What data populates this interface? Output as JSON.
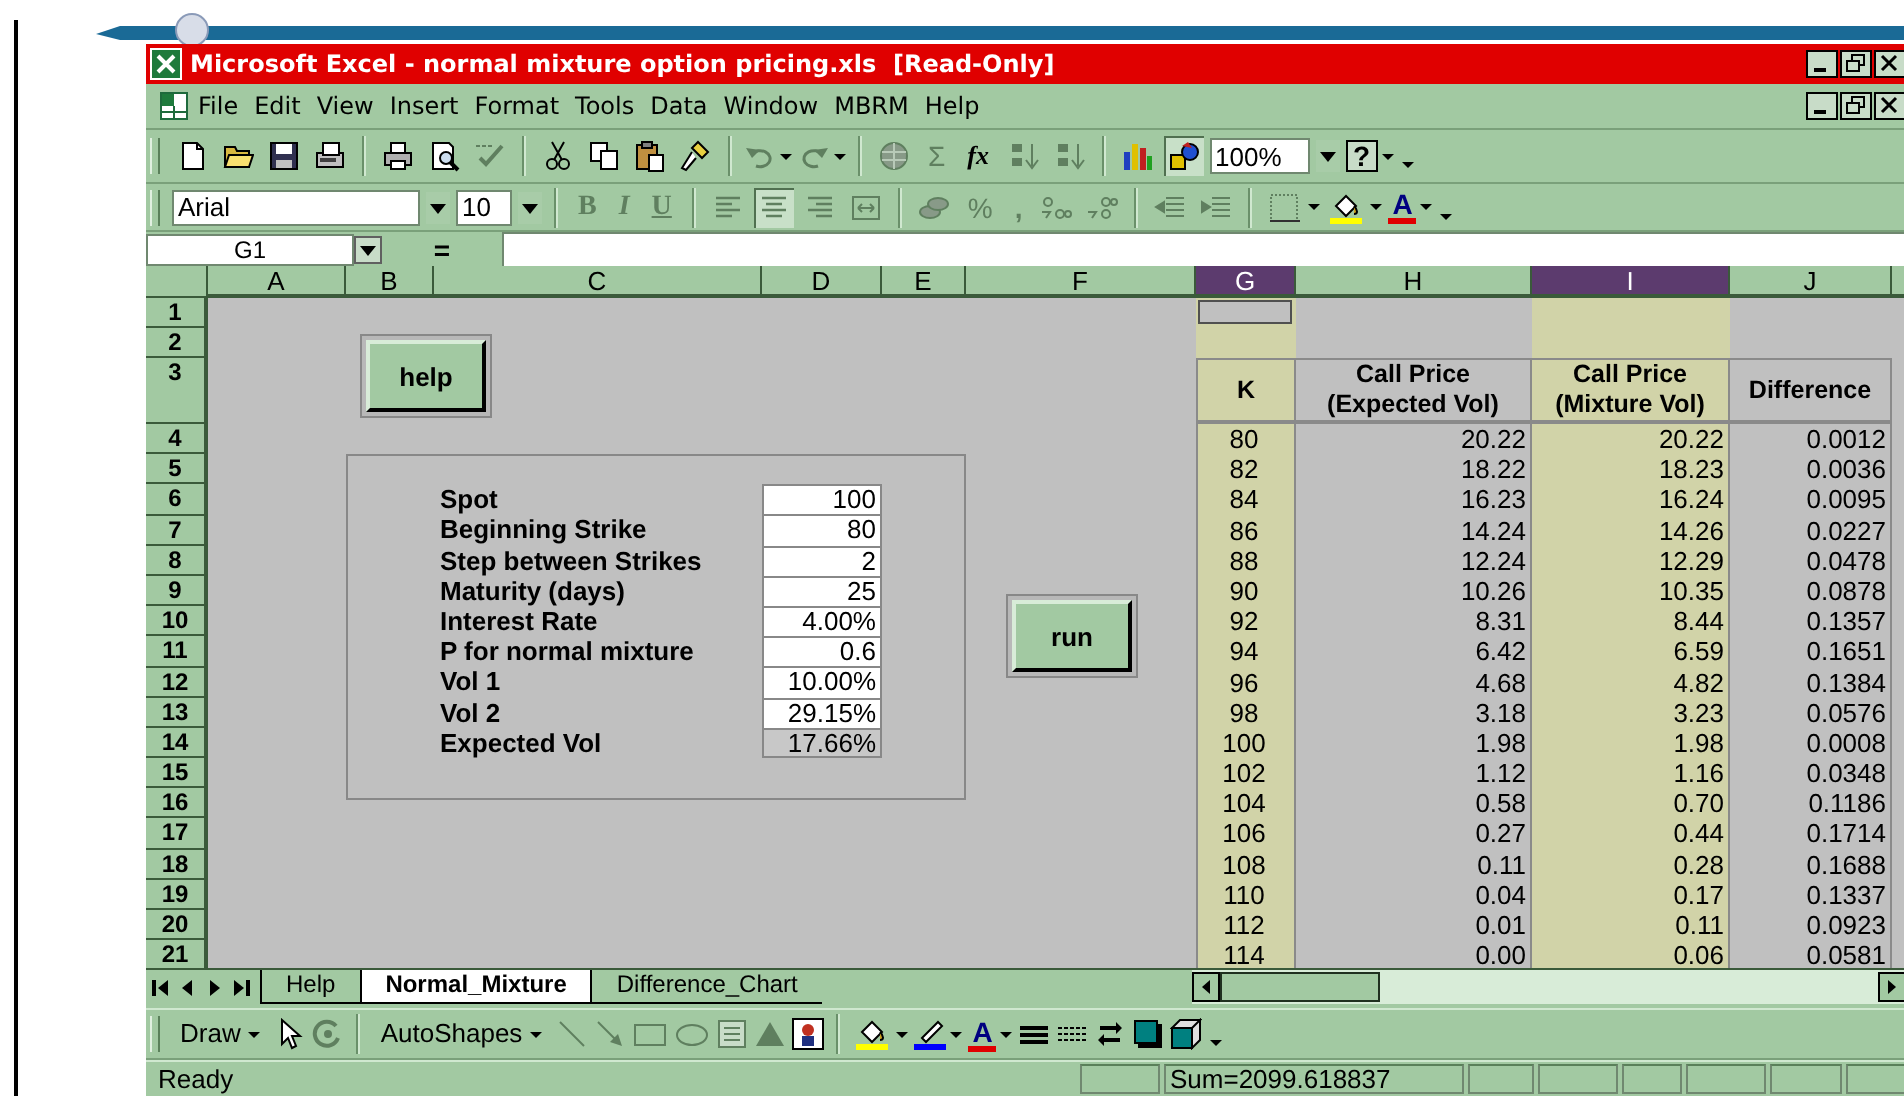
{
  "window": {
    "title": "Microsoft Excel - normal mixture option pricing.xls  [Read-Only]"
  },
  "menu": [
    "File",
    "Edit",
    "View",
    "Insert",
    "Format",
    "Tools",
    "Data",
    "Window",
    "MBRM",
    "Help"
  ],
  "standard_toolbar": {
    "autosum": "Σ",
    "function": "fx",
    "zoom": "100%",
    "help": "?"
  },
  "formatting_toolbar": {
    "font": "Arial",
    "size": "10",
    "bold": "B",
    "italic": "I",
    "underline": "U",
    "percent": "%",
    "comma": ",",
    "font_color": "A"
  },
  "formula_bar": {
    "name_box": "G1",
    "equals": "="
  },
  "columns": [
    {
      "letter": "A",
      "selected": false
    },
    {
      "letter": "B",
      "selected": false
    },
    {
      "letter": "C",
      "selected": false
    },
    {
      "letter": "D",
      "selected": false
    },
    {
      "letter": "E",
      "selected": false
    },
    {
      "letter": "F",
      "selected": false
    },
    {
      "letter": "G",
      "selected": true
    },
    {
      "letter": "H",
      "selected": false
    },
    {
      "letter": "I",
      "selected": true
    },
    {
      "letter": "J",
      "selected": false
    }
  ],
  "row_numbers": [
    "1",
    "2",
    "3",
    "4",
    "5",
    "6",
    "7",
    "8",
    "9",
    "10",
    "11",
    "12",
    "13",
    "14",
    "15",
    "16",
    "17",
    "18",
    "19",
    "20",
    "21"
  ],
  "help_button": "help",
  "run_button": "run",
  "parameters": [
    {
      "label": "Spot",
      "value": "100",
      "kind": "input"
    },
    {
      "label": "Beginning Strike",
      "value": "80",
      "kind": "input"
    },
    {
      "label": "Step between Strikes",
      "value": "2",
      "kind": "input"
    },
    {
      "label": "Maturity (days)",
      "value": "25",
      "kind": "input"
    },
    {
      "label": "Interest Rate",
      "value": "4.00%",
      "kind": "input"
    },
    {
      "label": "P for normal mixture",
      "value": "0.6",
      "kind": "input"
    },
    {
      "label": "Vol 1",
      "value": "10.00%",
      "kind": "input"
    },
    {
      "label": "Vol 2",
      "value": "29.15%",
      "kind": "input"
    },
    {
      "label": "Expected Vol",
      "value": "17.66%",
      "kind": "output"
    }
  ],
  "results": {
    "columns": [
      "K",
      "Call Price (Expected Vol)",
      "Call Price (Mixture Vol)",
      "Difference"
    ],
    "rows": [
      [
        "80",
        "20.22",
        "20.22",
        "0.0012"
      ],
      [
        "82",
        "18.22",
        "18.23",
        "0.0036"
      ],
      [
        "84",
        "16.23",
        "16.24",
        "0.0095"
      ],
      [
        "86",
        "14.24",
        "14.26",
        "0.0227"
      ],
      [
        "88",
        "12.24",
        "12.29",
        "0.0478"
      ],
      [
        "90",
        "10.26",
        "10.35",
        "0.0878"
      ],
      [
        "92",
        "8.31",
        "8.44",
        "0.1357"
      ],
      [
        "94",
        "6.42",
        "6.59",
        "0.1651"
      ],
      [
        "96",
        "4.68",
        "4.82",
        "0.1384"
      ],
      [
        "98",
        "3.18",
        "3.23",
        "0.0576"
      ],
      [
        "100",
        "1.98",
        "1.98",
        "0.0008"
      ],
      [
        "102",
        "1.12",
        "1.16",
        "0.0348"
      ],
      [
        "104",
        "0.58",
        "0.70",
        "0.1186"
      ],
      [
        "106",
        "0.27",
        "0.44",
        "0.1714"
      ],
      [
        "108",
        "0.11",
        "0.28",
        "0.1688"
      ],
      [
        "110",
        "0.04",
        "0.17",
        "0.1337"
      ],
      [
        "112",
        "0.01",
        "0.11",
        "0.0923"
      ],
      [
        "114",
        "0.00",
        "0.06",
        "0.0581"
      ]
    ]
  },
  "sheet_tabs": [
    {
      "label": "Help",
      "selected": false
    },
    {
      "label": "Normal_Mixture",
      "selected": true
    },
    {
      "label": "Difference_Chart",
      "selected": false
    }
  ],
  "drawing_toolbar": {
    "draw": "Draw",
    "autoshapes": "AutoShapes",
    "font_color": "A"
  },
  "status_bar": {
    "mode": "Ready",
    "sum": "Sum=2099.618837"
  }
}
